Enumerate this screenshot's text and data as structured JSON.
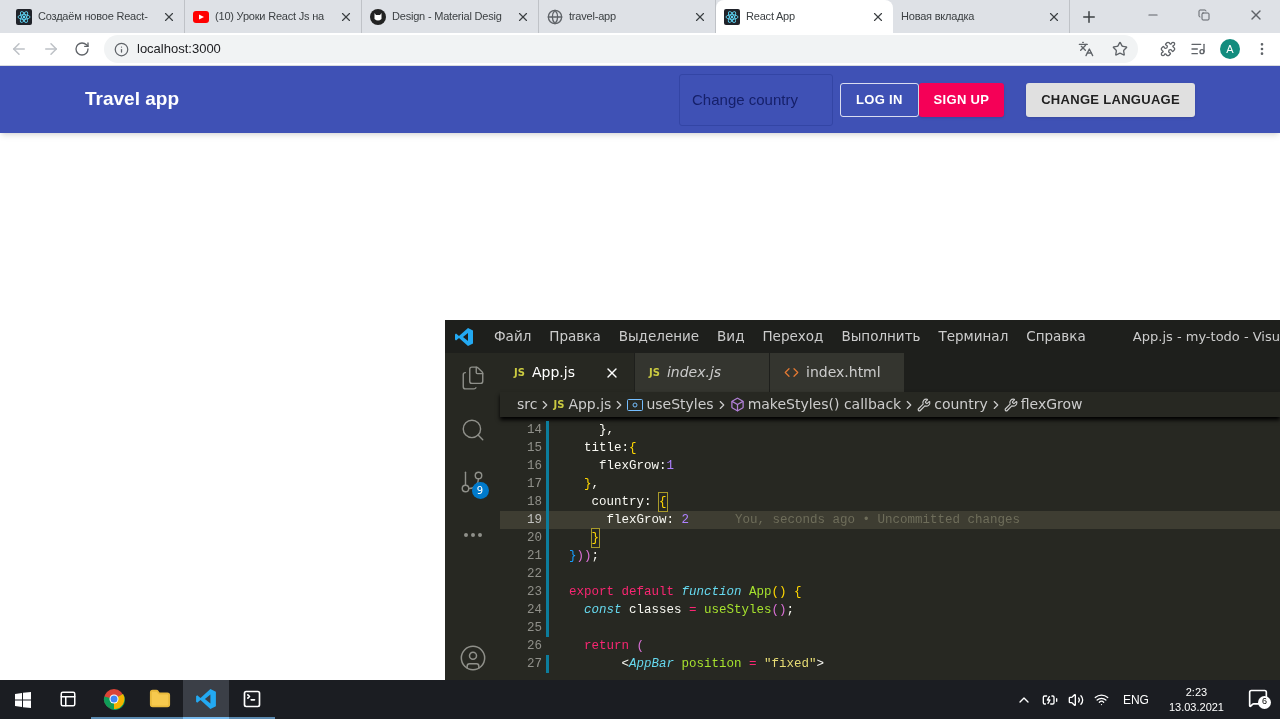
{
  "browser": {
    "tabs": [
      {
        "title": "Создаём новое React-",
        "kind": "react",
        "selected": false
      },
      {
        "title": "(10) Уроки React Js на",
        "kind": "youtube",
        "selected": false
      },
      {
        "title": "Design - Material Desig",
        "kind": "github",
        "selected": false
      },
      {
        "title": "travel-app",
        "kind": "globe",
        "selected": false
      },
      {
        "title": "React App",
        "kind": "react",
        "selected": true
      },
      {
        "title": "Новая вкладка",
        "selected": false
      }
    ],
    "address": "localhost:3000",
    "avatar": "A"
  },
  "page": {
    "app_bar": {
      "title": "Travel app",
      "country_field": {
        "placeholder": "Change country"
      },
      "buttons": [
        {
          "label": "LOG IN",
          "kind": "outlined"
        },
        {
          "label": "SIGN UP",
          "kind": "pink"
        },
        {
          "label": "CHANGE LANGUAGE",
          "kind": "gray"
        }
      ]
    }
  },
  "editor": {
    "menu": [
      "Файл",
      "Правка",
      "Выделение",
      "Вид",
      "Переход",
      "Выполнить",
      "Терминал",
      "Справка"
    ],
    "title": "App.js - my-todo - Visu",
    "source_control_badge": "9",
    "tabs": [
      {
        "label": "App.js",
        "kind": "js",
        "badge": "JS",
        "selected": true,
        "preview": false
      },
      {
        "label": "index.js",
        "kind": "js",
        "badge": "JS",
        "selected": false,
        "preview": true
      },
      {
        "label": "index.html",
        "kind": "html",
        "selected": false,
        "preview": false
      }
    ],
    "breadcrumb": [
      {
        "label": "src",
        "kind": "folder"
      },
      {
        "label": "App.js",
        "kind": "js",
        "badge": "JS"
      },
      {
        "label": "useStyles",
        "kind": "variable"
      },
      {
        "label": "makeStyles() callback",
        "kind": "method"
      },
      {
        "label": "country",
        "kind": "property"
      },
      {
        "label": "flexGrow",
        "kind": "property"
      }
    ],
    "lines": [
      {
        "number": "14",
        "changed": true,
        "current": false,
        "tokens": [
          {
            "text": "    },",
            "kind": "plain"
          }
        ]
      },
      {
        "number": "15",
        "changed": true,
        "current": false,
        "tokens": [
          {
            "text": "  title:",
            "kind": "plain"
          },
          {
            "text": "{",
            "kind": "b1"
          }
        ]
      },
      {
        "number": "16",
        "changed": true,
        "current": false,
        "tokens": [
          {
            "text": "    flexGrow:",
            "kind": "plain"
          },
          {
            "text": "1",
            "kind": "number"
          }
        ]
      },
      {
        "number": "17",
        "changed": true,
        "current": false,
        "tokens": [
          {
            "text": "  }",
            "kind": "b1"
          },
          {
            "text": ",",
            "kind": "plain"
          }
        ]
      },
      {
        "number": "18",
        "changed": true,
        "current": false,
        "tokens": [
          {
            "text": "   country: ",
            "kind": "plain"
          },
          {
            "text": "{",
            "kind": "match"
          }
        ]
      },
      {
        "number": "19",
        "changed": true,
        "current": true,
        "tokens": [
          {
            "text": "     flexGrow: ",
            "kind": "plain"
          },
          {
            "text": "2",
            "kind": "number"
          },
          {
            "text": "You, seconds ago • Uncommitted changes",
            "kind": "ghost"
          }
        ]
      },
      {
        "number": "20",
        "changed": true,
        "current": false,
        "tokens": [
          {
            "text": "   }",
            "kind": "match"
          }
        ]
      },
      {
        "number": "21",
        "changed": true,
        "current": false,
        "tokens": [
          {
            "text": "}",
            "kind": "b3"
          },
          {
            "text": "))",
            "kind": "b2"
          },
          {
            "text": ";",
            "kind": "plain"
          }
        ]
      },
      {
        "number": "22",
        "changed": true,
        "current": false
      },
      {
        "number": "23",
        "changed": true,
        "current": false,
        "tokens": [
          {
            "text": "export default ",
            "kind": "keyword"
          },
          {
            "text": "function ",
            "kind": "storage"
          },
          {
            "text": "App",
            "kind": "fn"
          },
          {
            "text": "() ",
            "kind": "b1"
          },
          {
            "text": "{",
            "kind": "b1"
          }
        ]
      },
      {
        "number": "24",
        "changed": true,
        "current": false,
        "tokens": [
          {
            "text": "  const ",
            "kind": "storage"
          },
          {
            "text": "classes ",
            "kind": "plain"
          },
          {
            "text": "= ",
            "kind": "keyword"
          },
          {
            "text": "useStyles",
            "kind": "fn"
          },
          {
            "text": "()",
            "kind": "b2"
          },
          {
            "text": ";",
            "kind": "plain"
          }
        ]
      },
      {
        "number": "25",
        "changed": true,
        "current": false
      },
      {
        "number": "26",
        "changed": false,
        "current": false,
        "tokens": [
          {
            "text": "  return ",
            "kind": "keyword"
          },
          {
            "text": "(",
            "kind": "b2"
          }
        ]
      },
      {
        "number": "27",
        "changed": true,
        "current": false,
        "tokens": [
          {
            "text": "       <",
            "kind": "plain"
          },
          {
            "text": "AppBar ",
            "kind": "storage"
          },
          {
            "text": "position ",
            "kind": "fn"
          },
          {
            "text": "= ",
            "kind": "keyword"
          },
          {
            "text": "\"fixed\"",
            "kind": "string"
          },
          {
            "text": ">",
            "kind": "plain"
          }
        ]
      }
    ]
  },
  "taskbar": {
    "apps": [
      {
        "kind": "taskview",
        "selected": false
      },
      {
        "kind": "chrome",
        "selected": false
      },
      {
        "kind": "explorer",
        "selected": false
      },
      {
        "kind": "vscode",
        "selected": true
      },
      {
        "kind": "terminal",
        "selected": false
      }
    ],
    "language": "ENG",
    "time": "2:23",
    "date": "13.03.2021",
    "notifications": "6"
  }
}
